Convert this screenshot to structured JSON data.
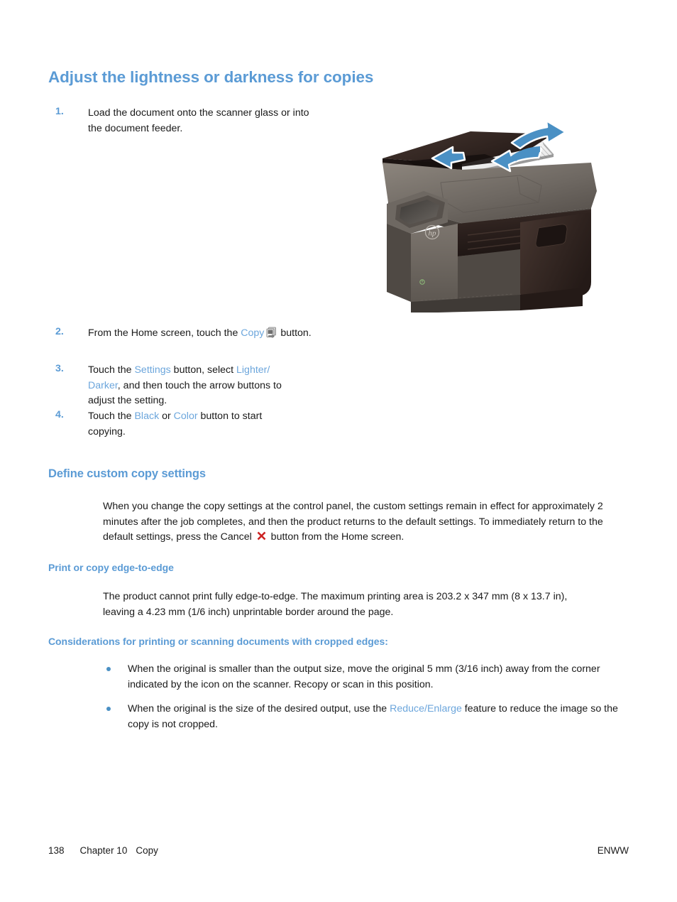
{
  "page": {
    "heading1": "Adjust the lightness or darkness for copies",
    "heading2": "Define custom copy settings",
    "heading3": "Print or copy edge-to-edge",
    "heading4": "Considerations for printing or scanning documents with cropped edges:"
  },
  "steps": [
    {
      "num": "1.",
      "text": "Load the document onto the scanner glass or into the document feeder."
    },
    {
      "num": "2.",
      "pre": "From the Home screen, touch the ",
      "link": "Copy",
      "post": " button."
    },
    {
      "num": "3.",
      "pre": "Touch the ",
      "link1": "Settings",
      "mid1": " button, select ",
      "link2": "Lighter/ Darker",
      "post": ", and then touch the arrow buttons to adjust the setting."
    },
    {
      "num": "4.",
      "pre": "Touch the ",
      "link1": "Black",
      "mid1": " or ",
      "link2": "Color",
      "post": " button to start copying."
    }
  ],
  "custom_settings": {
    "para_pre": "When you change the copy settings at the control panel, the custom settings remain in effect for approximately 2 minutes after the job completes, and then the product returns to the default settings. To immediately return to the default settings, press the Cancel ",
    "para_post": " button from the Home screen."
  },
  "edge_to_edge": {
    "paragraph": "The product cannot print fully edge-to-edge. The maximum printing area is 203.2 x 347 mm (8 x 13.7 in), leaving a 4.23 mm (1/6 inch) unprintable border around the page."
  },
  "bullets": [
    {
      "text": "When the original is smaller than the output size, move the original 5 mm (3/16 inch) away from the corner indicated by the icon on the scanner. Recopy or scan in this position."
    },
    {
      "pre": "When the original is the size of the desired output, use the ",
      "link": "Reduce/Enlarge",
      "post": " feature to reduce the image so the copy is not cropped."
    }
  ],
  "footer": {
    "page_number": "138",
    "chapter": "Chapter 10",
    "chapter_title": "Copy",
    "right": "ENWW"
  },
  "colors": {
    "heading_blue": "#5b9bd5",
    "link_blue": "#6ca6dc",
    "cancel_red": "#cc2222",
    "arrow_blue": "#4a90c4",
    "printer_body": "#6e6862",
    "printer_dark": "#2a1f1c"
  }
}
